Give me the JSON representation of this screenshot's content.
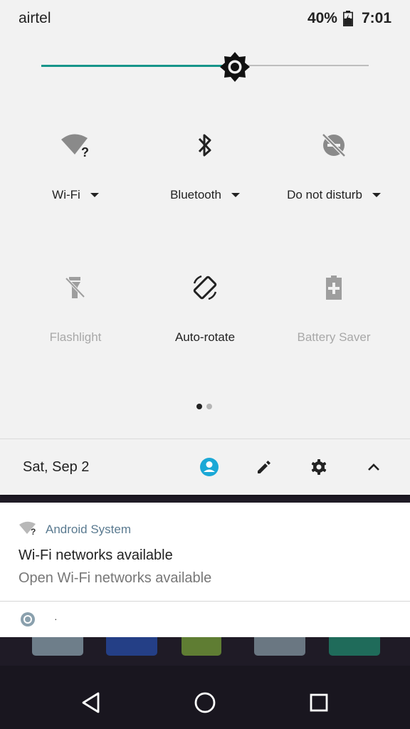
{
  "status_bar": {
    "carrier": "airtel",
    "battery_percent": "40%",
    "time": "7:01",
    "battery_icon": "battery-charging-icon"
  },
  "brightness": {
    "level": 0.6,
    "accent_color": "#17958a",
    "icon": "brightness-icon"
  },
  "tiles": [
    {
      "label": "Wi-Fi",
      "icon": "wifi-question-icon",
      "has_dropdown": true,
      "enabled": true
    },
    {
      "label": "Bluetooth",
      "icon": "bluetooth-icon",
      "has_dropdown": true,
      "enabled": true
    },
    {
      "label": "Do not disturb",
      "icon": "do-not-disturb-off-icon",
      "has_dropdown": true,
      "enabled": true
    },
    {
      "label": "Flashlight",
      "icon": "flashlight-off-icon",
      "has_dropdown": false,
      "enabled": false
    },
    {
      "label": "Auto-rotate",
      "icon": "auto-rotate-icon",
      "has_dropdown": false,
      "enabled": true
    },
    {
      "label": "Battery Saver",
      "icon": "battery-saver-icon",
      "has_dropdown": false,
      "enabled": false
    }
  ],
  "page_indicator": {
    "pages": 2,
    "current": 1
  },
  "footer": {
    "date": "Sat, Sep 2",
    "user_color": "#1ba8d6",
    "buttons": [
      "user-icon",
      "edit-icon",
      "settings-icon",
      "collapse-icon"
    ]
  },
  "notifications": [
    {
      "app": "Android System",
      "icon": "wifi-question-icon",
      "title": "Wi-Fi networks available",
      "text": "Open Wi-Fi networks available"
    },
    {
      "icon": "circle-app-icon",
      "text": "·"
    }
  ],
  "nav_bar": {
    "buttons": [
      "back-icon",
      "home-icon",
      "recents-icon"
    ]
  }
}
